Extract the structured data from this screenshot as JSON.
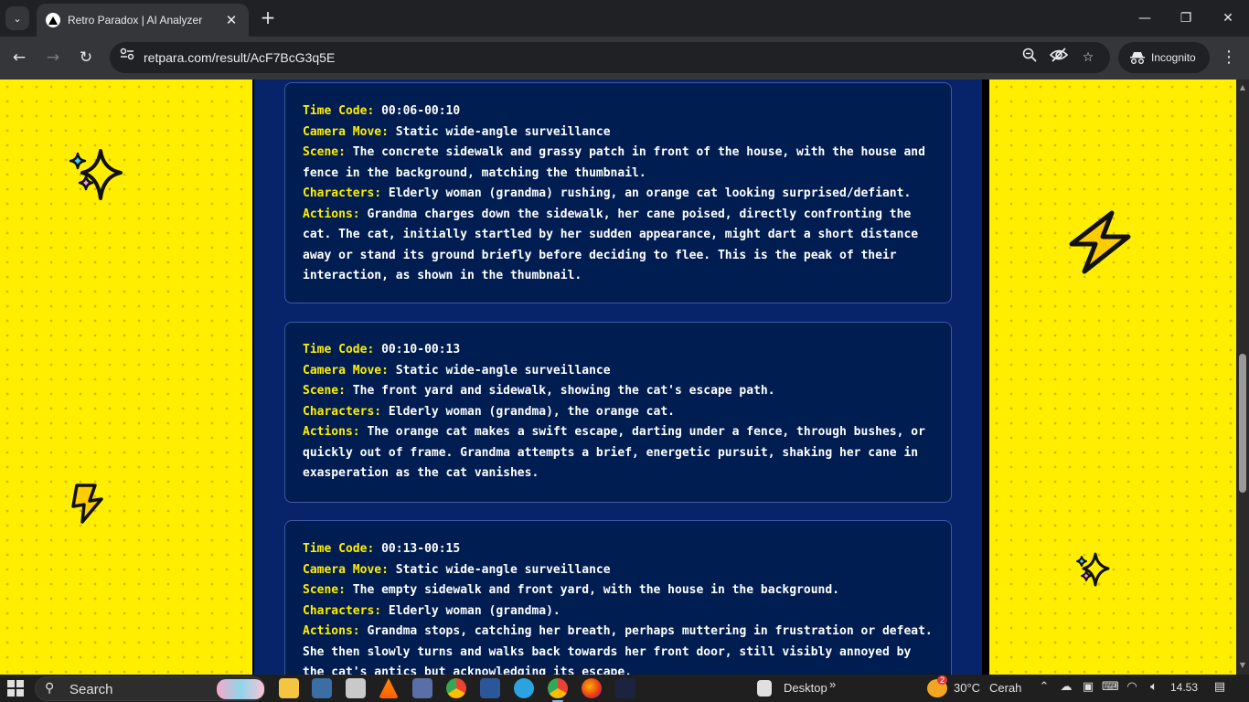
{
  "browser": {
    "tab_title": "Retro Paradox | AI Analyzer",
    "tab_close": "✕",
    "new_tab": "+",
    "url": "retpara.com/result/AcF7BcG3q5E",
    "incognito_label": "Incognito",
    "window_controls": {
      "minimize": "—",
      "maximize": "❐",
      "close": "✕"
    }
  },
  "colors": {
    "page_background": "#ffee00",
    "center_panel": "#07246a",
    "card_background": "#001d52",
    "label_color": "#ffee00",
    "text_color": "#ffffff"
  },
  "cards": [
    {
      "time_code_label": "Time Code:",
      "time_code": "00:06-00:10",
      "camera_label": "Camera Move:",
      "camera": "Static wide-angle surveillance",
      "scene_label": "Scene:",
      "scene": "The concrete sidewalk and grassy patch in front of the house, with the house and fence in the background, matching the thumbnail.",
      "characters_label": "Characters:",
      "characters": "Elderly woman (grandma) rushing, an orange cat looking surprised/defiant.",
      "actions_label": "Actions:",
      "actions": "Grandma charges down the sidewalk, her cane poised, directly confronting the cat. The cat, initially startled by her sudden appearance, might dart a short distance away or stand its ground briefly before deciding to flee. This is the peak of their interaction, as shown in the thumbnail."
    },
    {
      "time_code_label": "Time Code:",
      "time_code": "00:10-00:13",
      "camera_label": "Camera Move:",
      "camera": "Static wide-angle surveillance",
      "scene_label": "Scene:",
      "scene": "The front yard and sidewalk, showing the cat's escape path.",
      "characters_label": "Characters:",
      "characters": "Elderly woman (grandma), the orange cat.",
      "actions_label": "Actions:",
      "actions": "The orange cat makes a swift escape, darting under a fence, through bushes, or quickly out of frame. Grandma attempts a brief, energetic pursuit, shaking her cane in exasperation as the cat vanishes."
    },
    {
      "time_code_label": "Time Code:",
      "time_code": "00:13-00:15",
      "camera_label": "Camera Move:",
      "camera": "Static wide-angle surveillance",
      "scene_label": "Scene:",
      "scene": "The empty sidewalk and front yard, with the house in the background.",
      "characters_label": "Characters:",
      "characters": "Elderly woman (grandma).",
      "actions_label": "Actions:",
      "actions": "Grandma stops, catching her breath, perhaps muttering in frustration or defeat. She then slowly turns and walks back towards her front door, still visibly annoyed by the cat's antics but acknowledging its escape."
    }
  ],
  "decorations": [
    "sparkle-icon",
    "lightning-icon",
    "lightning-icon",
    "sparkle-icon"
  ],
  "taskbar": {
    "search_label": "Search",
    "desktop_label": "Desktop",
    "overflow": "»",
    "weather_temp": "30°C",
    "weather_desc": "Cerah",
    "weather_badge": "2",
    "time": "14.53",
    "apps": [
      "file-explorer-icon",
      "keyboard-icon",
      "paint-icon",
      "vlc-icon",
      "app-icon",
      "chrome-icon",
      "word-icon",
      "telegram-icon",
      "chrome-active-icon",
      "firefox-icon",
      "arc-icon"
    ]
  }
}
